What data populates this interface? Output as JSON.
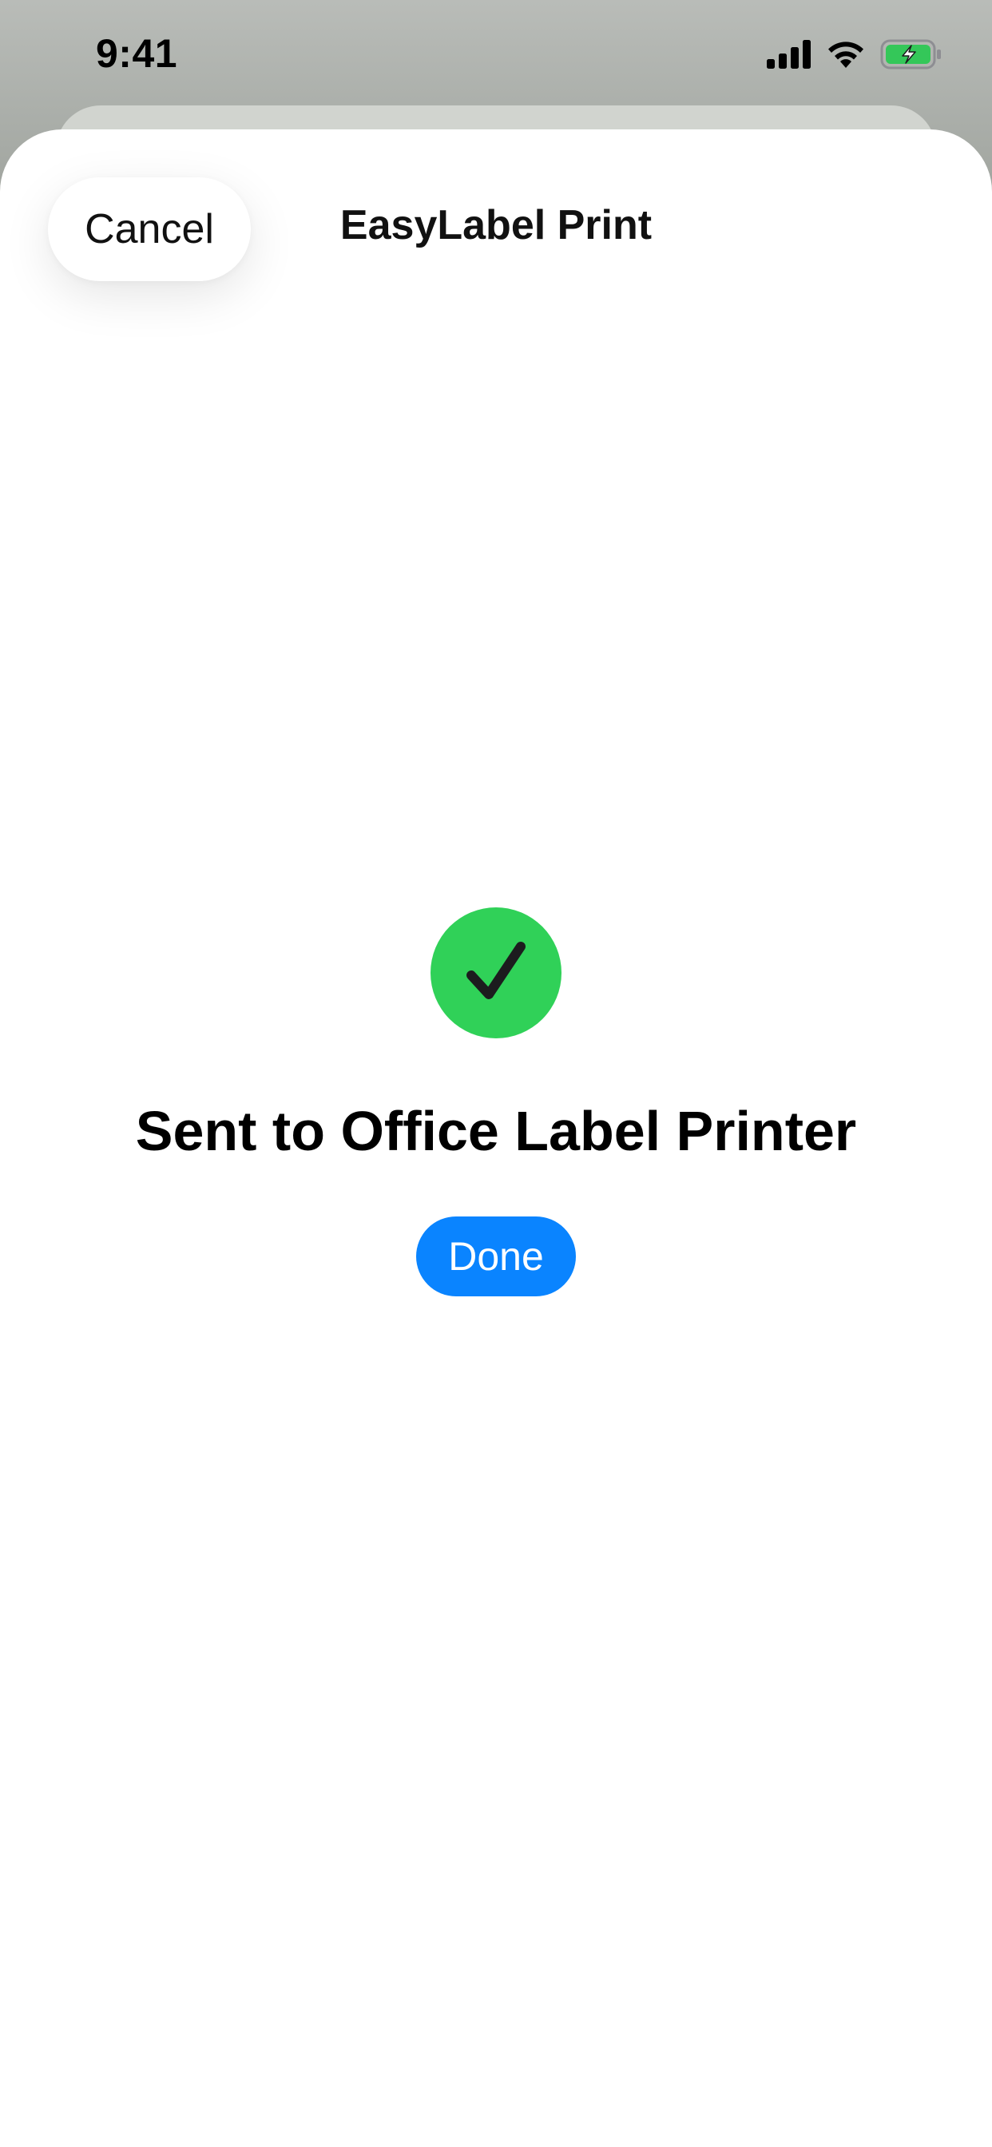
{
  "status_bar": {
    "time": "9:41",
    "icons": [
      "cellular-signal-icon",
      "wifi-icon",
      "battery-charging-icon"
    ],
    "battery_color": "#34c759"
  },
  "sheet": {
    "cancel_label": "Cancel",
    "title": "EasyLabel Print"
  },
  "confirmation": {
    "icon": "checkmark-circle-icon",
    "icon_color": "#30d158",
    "message": "Sent to Office Label Printer",
    "done_label": "Done",
    "done_color": "#0a84ff"
  }
}
